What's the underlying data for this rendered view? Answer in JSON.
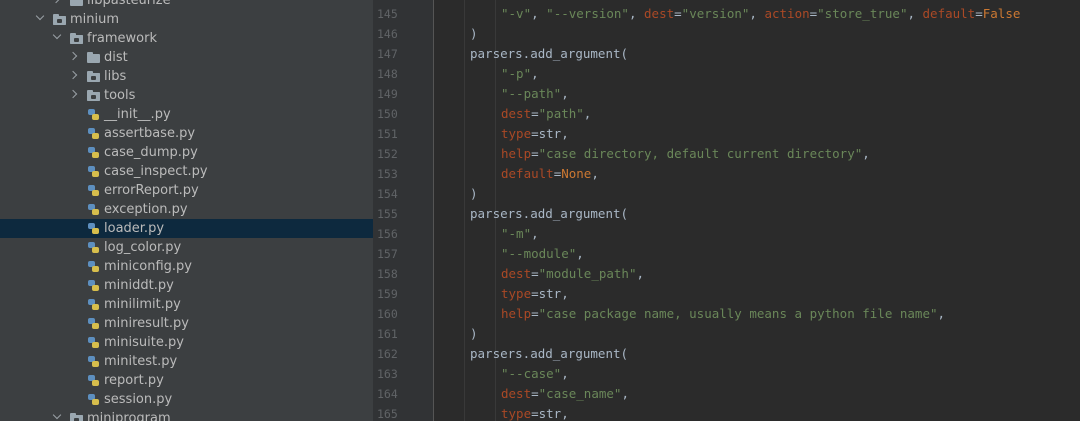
{
  "project_tree": {
    "items": [
      {
        "label": "libpasteurize",
        "kind": "folder",
        "depth": 2,
        "chevron": "closed",
        "selected": false
      },
      {
        "label": "minium",
        "kind": "folder-pkg",
        "depth": 1,
        "chevron": "open",
        "selected": false
      },
      {
        "label": "framework",
        "kind": "folder-pkg",
        "depth": 2,
        "chevron": "open",
        "selected": false
      },
      {
        "label": "dist",
        "kind": "folder",
        "depth": 3,
        "chevron": "closed",
        "selected": false
      },
      {
        "label": "libs",
        "kind": "folder-pkg",
        "depth": 3,
        "chevron": "closed",
        "selected": false
      },
      {
        "label": "tools",
        "kind": "folder-pkg",
        "depth": 3,
        "chevron": "closed",
        "selected": false
      },
      {
        "label": "__init__.py",
        "kind": "python-file",
        "depth": 4,
        "chevron": "none",
        "selected": false
      },
      {
        "label": "assertbase.py",
        "kind": "python-file",
        "depth": 4,
        "chevron": "none",
        "selected": false
      },
      {
        "label": "case_dump.py",
        "kind": "python-file",
        "depth": 4,
        "chevron": "none",
        "selected": false
      },
      {
        "label": "case_inspect.py",
        "kind": "python-file",
        "depth": 4,
        "chevron": "none",
        "selected": false
      },
      {
        "label": "errorReport.py",
        "kind": "python-file",
        "depth": 4,
        "chevron": "none",
        "selected": false
      },
      {
        "label": "exception.py",
        "kind": "python-file",
        "depth": 4,
        "chevron": "none",
        "selected": false
      },
      {
        "label": "loader.py",
        "kind": "python-file",
        "depth": 4,
        "chevron": "none",
        "selected": true
      },
      {
        "label": "log_color.py",
        "kind": "python-file",
        "depth": 4,
        "chevron": "none",
        "selected": false
      },
      {
        "label": "miniconfig.py",
        "kind": "python-file",
        "depth": 4,
        "chevron": "none",
        "selected": false
      },
      {
        "label": "miniddt.py",
        "kind": "python-file",
        "depth": 4,
        "chevron": "none",
        "selected": false
      },
      {
        "label": "minilimit.py",
        "kind": "python-file",
        "depth": 4,
        "chevron": "none",
        "selected": false
      },
      {
        "label": "miniresult.py",
        "kind": "python-file",
        "depth": 4,
        "chevron": "none",
        "selected": false
      },
      {
        "label": "minisuite.py",
        "kind": "python-file",
        "depth": 4,
        "chevron": "none",
        "selected": false
      },
      {
        "label": "minitest.py",
        "kind": "python-file",
        "depth": 4,
        "chevron": "none",
        "selected": false
      },
      {
        "label": "report.py",
        "kind": "python-file",
        "depth": 4,
        "chevron": "none",
        "selected": false
      },
      {
        "label": "session.py",
        "kind": "python-file",
        "depth": 4,
        "chevron": "none",
        "selected": false
      },
      {
        "label": "miniprogram",
        "kind": "folder-pkg",
        "depth": 2,
        "chevron": "open",
        "selected": false
      }
    ]
  },
  "editor": {
    "lines": [
      {
        "n": "145",
        "indent": 2,
        "tokens": [
          [
            "s",
            "\"-v\""
          ],
          [
            "p",
            ", "
          ],
          [
            "s",
            "\"--version\""
          ],
          [
            "p",
            ", "
          ],
          [
            "k",
            "dest"
          ],
          [
            "p",
            "="
          ],
          [
            "s",
            "\"version\""
          ],
          [
            "p",
            ", "
          ],
          [
            "k",
            "action"
          ],
          [
            "p",
            "="
          ],
          [
            "s",
            "\"store_true\""
          ],
          [
            "p",
            ", "
          ],
          [
            "k",
            "default"
          ],
          [
            "p",
            "="
          ],
          [
            "c",
            "False"
          ]
        ]
      },
      {
        "n": "146",
        "indent": 1,
        "tokens": [
          [
            "p",
            ")"
          ]
        ]
      },
      {
        "n": "147",
        "indent": 1,
        "tokens": [
          [
            "p",
            "parsers.add_argument("
          ]
        ]
      },
      {
        "n": "148",
        "indent": 2,
        "tokens": [
          [
            "s",
            "\"-p\""
          ],
          [
            "p",
            ","
          ]
        ]
      },
      {
        "n": "149",
        "indent": 2,
        "tokens": [
          [
            "s",
            "\"--path\""
          ],
          [
            "p",
            ","
          ]
        ]
      },
      {
        "n": "150",
        "indent": 2,
        "tokens": [
          [
            "k",
            "dest"
          ],
          [
            "p",
            "="
          ],
          [
            "s",
            "\"path\""
          ],
          [
            "p",
            ","
          ]
        ]
      },
      {
        "n": "151",
        "indent": 2,
        "tokens": [
          [
            "k",
            "type"
          ],
          [
            "p",
            "=str,"
          ]
        ]
      },
      {
        "n": "152",
        "indent": 2,
        "tokens": [
          [
            "k",
            "help"
          ],
          [
            "p",
            "="
          ],
          [
            "s",
            "\"case directory, default current directory\""
          ],
          [
            "p",
            ","
          ]
        ]
      },
      {
        "n": "153",
        "indent": 2,
        "tokens": [
          [
            "k",
            "default"
          ],
          [
            "p",
            "="
          ],
          [
            "c",
            "None"
          ],
          [
            "p",
            ","
          ]
        ]
      },
      {
        "n": "154",
        "indent": 1,
        "tokens": [
          [
            "p",
            ")"
          ]
        ]
      },
      {
        "n": "155",
        "indent": 1,
        "tokens": [
          [
            "p",
            "parsers.add_argument("
          ]
        ]
      },
      {
        "n": "156",
        "indent": 2,
        "tokens": [
          [
            "s",
            "\"-m\""
          ],
          [
            "p",
            ","
          ]
        ]
      },
      {
        "n": "157",
        "indent": 2,
        "tokens": [
          [
            "s",
            "\"--module\""
          ],
          [
            "p",
            ","
          ]
        ]
      },
      {
        "n": "158",
        "indent": 2,
        "tokens": [
          [
            "k",
            "dest"
          ],
          [
            "p",
            "="
          ],
          [
            "s",
            "\"module_path\""
          ],
          [
            "p",
            ","
          ]
        ]
      },
      {
        "n": "159",
        "indent": 2,
        "tokens": [
          [
            "k",
            "type"
          ],
          [
            "p",
            "=str,"
          ]
        ]
      },
      {
        "n": "160",
        "indent": 2,
        "tokens": [
          [
            "k",
            "help"
          ],
          [
            "p",
            "="
          ],
          [
            "s",
            "\"case package name, usually means a python file name\""
          ],
          [
            "p",
            ","
          ]
        ]
      },
      {
        "n": "161",
        "indent": 1,
        "tokens": [
          [
            "p",
            ")"
          ]
        ]
      },
      {
        "n": "162",
        "indent": 1,
        "tokens": [
          [
            "p",
            "parsers.add_argument("
          ]
        ]
      },
      {
        "n": "163",
        "indent": 2,
        "tokens": [
          [
            "s",
            "\"--case\""
          ],
          [
            "p",
            ","
          ]
        ]
      },
      {
        "n": "164",
        "indent": 2,
        "tokens": [
          [
            "k",
            "dest"
          ],
          [
            "p",
            "="
          ],
          [
            "s",
            "\"case_name\""
          ],
          [
            "p",
            ","
          ]
        ]
      },
      {
        "n": "165",
        "indent": 2,
        "tokens": [
          [
            "k",
            "type"
          ],
          [
            "p",
            "=str,"
          ]
        ]
      }
    ]
  },
  "colors": {
    "editor_bg": "#2b2b2b",
    "gutter_bg": "#313335",
    "tree_bg": "#3c3f41",
    "selection_bg": "#0d293e",
    "string": "#6a8759",
    "keyword_arg": "#aa4926",
    "constant": "#cc7832",
    "text": "#a9b7c6",
    "line_number": "#606366"
  }
}
